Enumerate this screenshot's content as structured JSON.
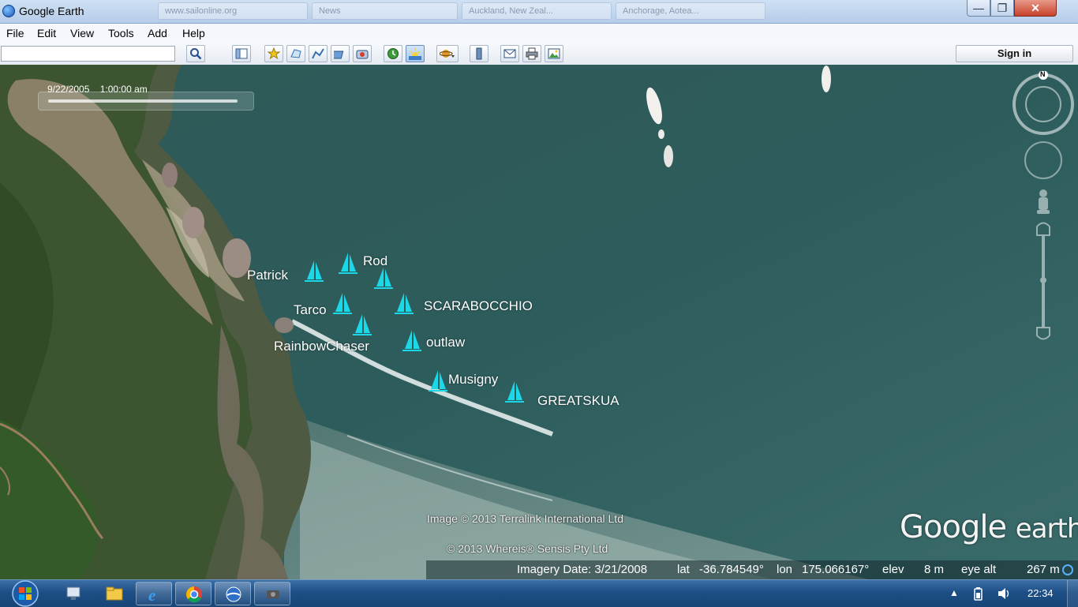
{
  "window": {
    "title": "Google Earth",
    "ghost_tabs": [
      "www.sailonline.org",
      "News",
      "Auckland, New Zeal...",
      "Anchorage, Aotea..."
    ],
    "min_glyph": "—",
    "max_glyph": "❐",
    "close_glyph": "✕"
  },
  "menu": {
    "items": [
      "File",
      "Edit",
      "View",
      "Tools",
      "Add",
      "Help"
    ]
  },
  "toolbar": {
    "search_value": "",
    "buttons": [
      "sidebar",
      "placemark",
      "polygon",
      "path",
      "image-overlay",
      "record-tour",
      "historical-imagery",
      "sunlight",
      "switch-planet",
      "ruler",
      "email",
      "print",
      "save-image"
    ],
    "sign_in_label": "Sign in"
  },
  "map": {
    "time_label": "9/22/2005    1:00:00 am",
    "compass_north": "N",
    "boats": [
      {
        "name": "Patrick"
      },
      {
        "name": "Rod"
      },
      {
        "name": "SCARABOCCHIO"
      },
      {
        "name": "Tarco"
      },
      {
        "name": "RainbowChaser"
      },
      {
        "name": "outlaw"
      },
      {
        "name": "Musigny"
      },
      {
        "name": "GREATSKUA"
      }
    ],
    "boat_icon_color": "#1ad8e8",
    "credit_1": "Image © 2013 Terralink International Ltd",
    "credit_2": "© 2013 Whereis® Sensis Pty Ltd",
    "logo_google": "Google",
    "logo_earth": "earth"
  },
  "status": {
    "imagery_date": "Imagery Date: 3/21/2008",
    "lat_label": "lat",
    "lat": "-36.784549°",
    "lon_label": "lon",
    "lon": "175.066167°",
    "elev_label": "elev",
    "elev": "8 m",
    "eye_label": "eye alt",
    "eye_alt": "267 m"
  },
  "taskbar": {
    "apps": [
      "windows-explorer-network",
      "file-explorer",
      "internet-explorer",
      "chrome",
      "google-earth",
      "media-player"
    ],
    "clock": "22:34",
    "tray_arrow": "▲"
  }
}
